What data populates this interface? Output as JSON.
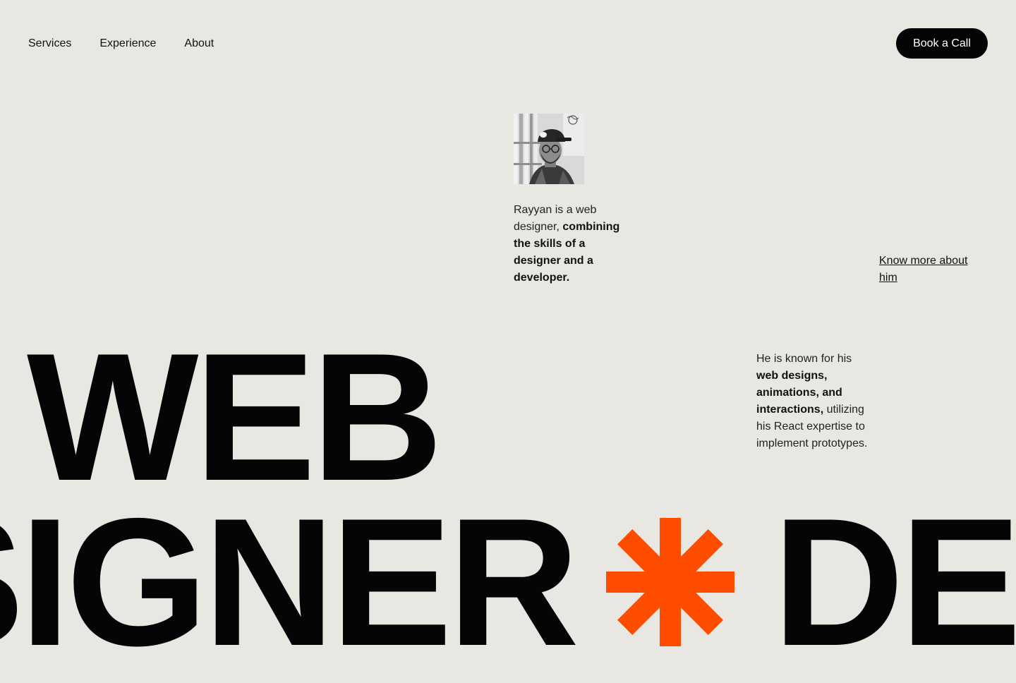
{
  "nav": {
    "links": [
      "Services",
      "Experience",
      "About"
    ],
    "cta_label": "Book a Call"
  },
  "portrait": {
    "icon": "person-portrait"
  },
  "intro": {
    "lead": "Rayyan is a web designer, ",
    "bold": "combining the skills of a designer and a developer."
  },
  "more_link": "Know more about him",
  "known": {
    "lead": "He is known for his ",
    "bold": "web designs, animations, and interactions,",
    "tail": " utilizing his React expertise to implement prototypes."
  },
  "hero": {
    "line1": "WEB",
    "line2_left": "SIGNER",
    "line2_right": "DEVELOPER"
  },
  "colors": {
    "background": "#e8e7e2",
    "accent": "#ff4d00",
    "ink": "#050505"
  }
}
